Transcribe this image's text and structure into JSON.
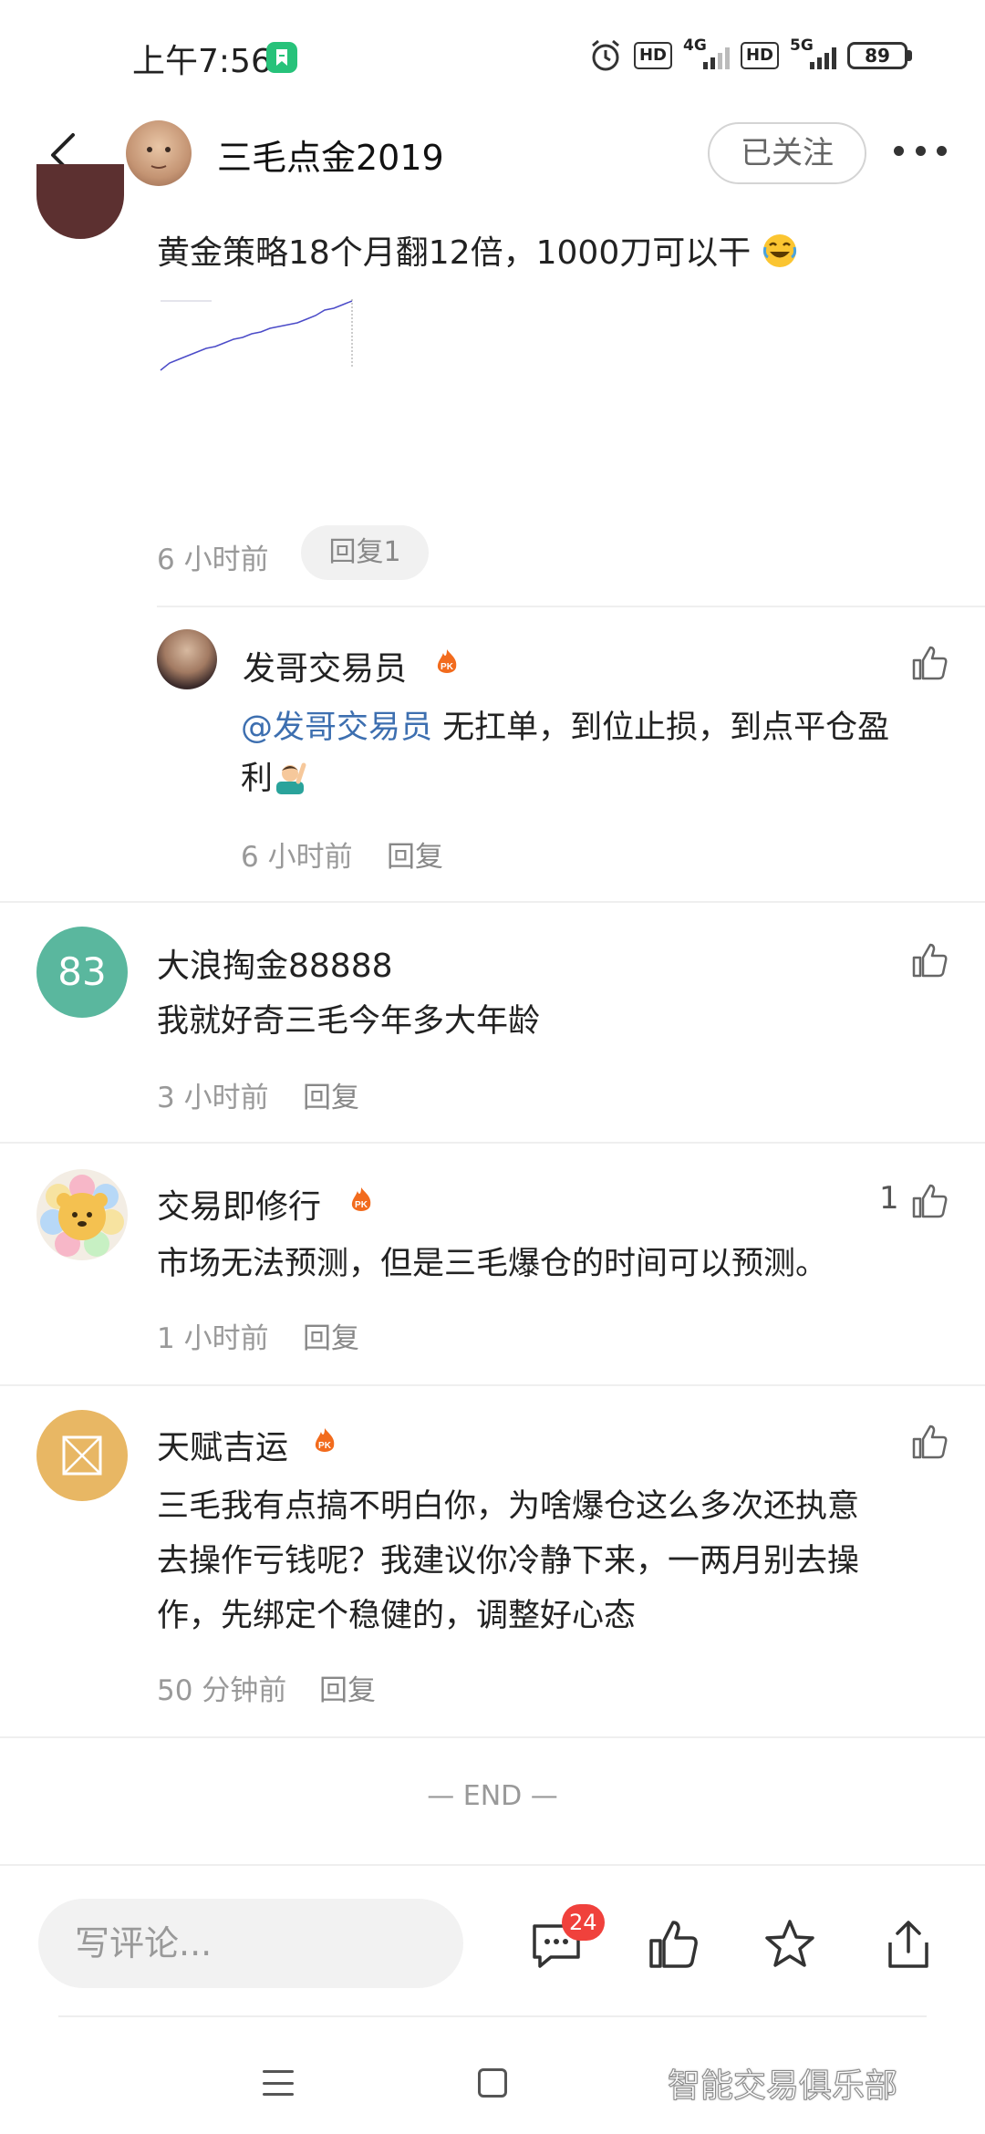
{
  "status": {
    "time": "上午7:56",
    "hd1": "HD",
    "net1": "4G",
    "hd2": "HD",
    "net2": "5G",
    "battery": "89"
  },
  "header": {
    "title": "三毛点金2019",
    "follow_label": "已关注"
  },
  "top_comment": {
    "text": "黄金策略18个月翻12倍，1000刀可以干",
    "time": "6 小时前",
    "reply_label": "回复1"
  },
  "nested_reply": {
    "name": "发哥交易员",
    "mention": "@发哥交易员",
    "text": " 无扛单，到位止损，到点平仓盈",
    "text2": "利",
    "time": "6 小时前",
    "reply_label": "回复"
  },
  "comments": [
    {
      "avatar_text": "83",
      "name": "大浪掏金88888",
      "text": "我就好奇三毛今年多大年龄",
      "time": "3 小时前",
      "reply_label": "回复"
    },
    {
      "name": "交易即修行",
      "likes": "1",
      "text": "市场无法预测，但是三毛爆仓的时间可以预测。",
      "time": "1 小时前",
      "reply_label": "回复"
    },
    {
      "name": "天赋吉运",
      "text_lines": [
        "三毛我有点搞不明白你，为啥爆仓这么多次还执意",
        "去操作亏钱呢？我建议你冷静下来，一两月别去操",
        "作，先绑定个稳健的，调整好心态"
      ],
      "time": "50 分钟前",
      "reply_label": "回复"
    }
  ],
  "end_label": "— END —",
  "bottom": {
    "input_placeholder": "写评论...",
    "comment_count": "24"
  },
  "watermark": "智能交易俱乐部",
  "colors": {
    "mention": "#3d6fb0",
    "badge": "#f0413c",
    "avatar_83": "#5ab79e",
    "avatar_gold": "#e8b764"
  }
}
